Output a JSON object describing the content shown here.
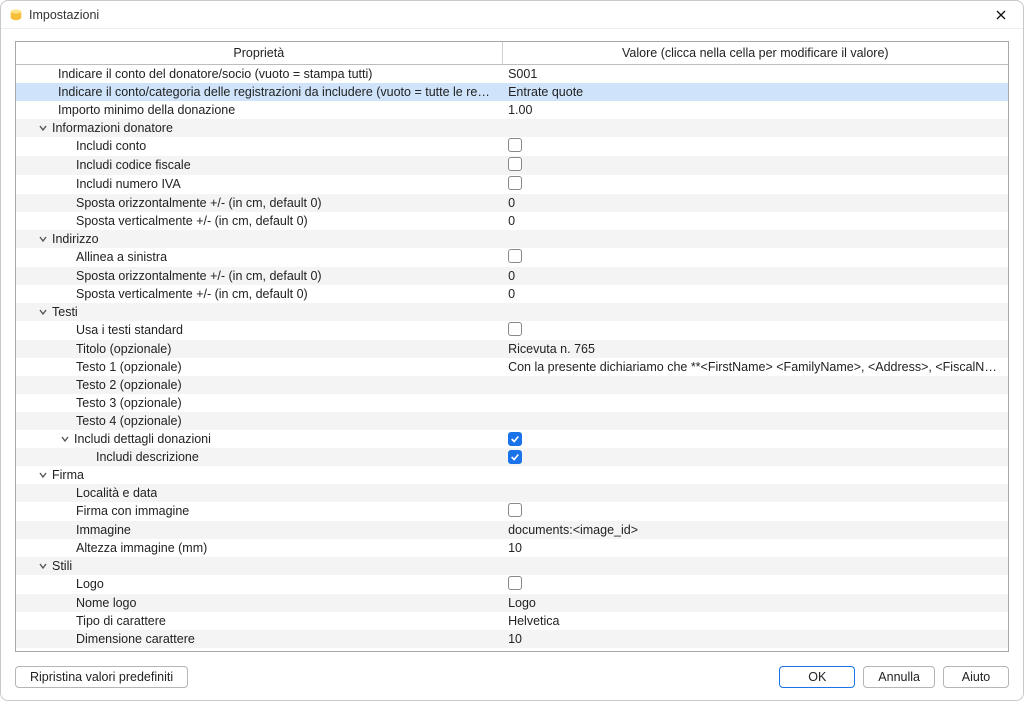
{
  "window": {
    "title": "Impostazioni"
  },
  "headers": {
    "property": "Proprietà",
    "value": "Valore (clicca nella cella per modificare il valore)"
  },
  "rows": [
    {
      "type": "leaf",
      "level": 1,
      "label": "Indicare il conto del donatore/socio (vuoto = stampa tutti)",
      "value": "S001",
      "valueType": "text",
      "selected": false
    },
    {
      "type": "leaf",
      "level": 1,
      "label": "Indicare il conto/categoria delle registrazioni da includere (vuoto = tutte le registrazioni)",
      "value": "Entrate quote",
      "valueType": "text",
      "selected": true
    },
    {
      "type": "leaf",
      "level": 1,
      "label": "Importo minimo della donazione",
      "value": "1.00",
      "valueType": "text"
    },
    {
      "type": "group",
      "level": 0,
      "label": "Informazioni donatore"
    },
    {
      "type": "leaf",
      "level": 2,
      "label": "Includi conto",
      "value": false,
      "valueType": "check"
    },
    {
      "type": "leaf",
      "level": 2,
      "label": "Includi codice fiscale",
      "value": false,
      "valueType": "check"
    },
    {
      "type": "leaf",
      "level": 2,
      "label": "Includi numero IVA",
      "value": false,
      "valueType": "check"
    },
    {
      "type": "leaf",
      "level": 2,
      "label": "Sposta orizzontalmente +/- (in cm, default 0)",
      "value": "0",
      "valueType": "text"
    },
    {
      "type": "leaf",
      "level": 2,
      "label": "Sposta verticalmente +/- (in cm, default 0)",
      "value": "0",
      "valueType": "text"
    },
    {
      "type": "group",
      "level": 0,
      "label": "Indirizzo"
    },
    {
      "type": "leaf",
      "level": 2,
      "label": "Allinea a sinistra",
      "value": false,
      "valueType": "check"
    },
    {
      "type": "leaf",
      "level": 2,
      "label": "Sposta orizzontalmente +/- (in cm, default 0)",
      "value": "0",
      "valueType": "text"
    },
    {
      "type": "leaf",
      "level": 2,
      "label": "Sposta verticalmente +/- (in cm, default 0)",
      "value": "0",
      "valueType": "text"
    },
    {
      "type": "group",
      "level": 0,
      "label": "Testi"
    },
    {
      "type": "leaf",
      "level": 2,
      "label": "Usa i testi standard",
      "value": false,
      "valueType": "check"
    },
    {
      "type": "leaf",
      "level": 2,
      "label": "Titolo (opzionale)",
      "value": "Ricevuta n. 765",
      "valueType": "text"
    },
    {
      "type": "leaf",
      "level": 2,
      "label": "Testo 1 (opzionale)",
      "value": "Con la presente dichiariamo che **<FirstName> <FamilyName>, <Address>, <FiscalNumber...",
      "valueType": "text"
    },
    {
      "type": "leaf",
      "level": 2,
      "label": "Testo 2 (opzionale)",
      "value": "",
      "valueType": "text"
    },
    {
      "type": "leaf",
      "level": 2,
      "label": "Testo 3 (opzionale)",
      "value": "",
      "valueType": "text"
    },
    {
      "type": "leaf",
      "level": 2,
      "label": "Testo 4 (opzionale)",
      "value": "",
      "valueType": "text"
    },
    {
      "type": "subgroup",
      "level": 1,
      "label": "Includi dettagli donazioni",
      "value": true,
      "valueType": "check"
    },
    {
      "type": "leaf",
      "level": 3,
      "label": "Includi descrizione",
      "value": true,
      "valueType": "check"
    },
    {
      "type": "group",
      "level": 0,
      "label": "Firma"
    },
    {
      "type": "leaf",
      "level": 2,
      "label": "Località e data",
      "value": "",
      "valueType": "text"
    },
    {
      "type": "leaf",
      "level": 2,
      "label": "Firma con immagine",
      "value": false,
      "valueType": "check"
    },
    {
      "type": "leaf",
      "level": 2,
      "label": "Immagine",
      "value": "documents:<image_id>",
      "valueType": "text"
    },
    {
      "type": "leaf",
      "level": 2,
      "label": "Altezza immagine (mm)",
      "value": "10",
      "valueType": "text"
    },
    {
      "type": "group",
      "level": 0,
      "label": "Stili"
    },
    {
      "type": "leaf",
      "level": 2,
      "label": "Logo",
      "value": false,
      "valueType": "check"
    },
    {
      "type": "leaf",
      "level": 2,
      "label": "Nome logo",
      "value": "Logo",
      "valueType": "text"
    },
    {
      "type": "leaf",
      "level": 2,
      "label": "Tipo di carattere",
      "value": "Helvetica",
      "valueType": "text"
    },
    {
      "type": "leaf",
      "level": 2,
      "label": "Dimensione carattere",
      "value": "10",
      "valueType": "text"
    }
  ],
  "buttons": {
    "restore": "Ripristina valori predefiniti",
    "ok": "OK",
    "cancel": "Annulla",
    "help": "Aiuto"
  }
}
